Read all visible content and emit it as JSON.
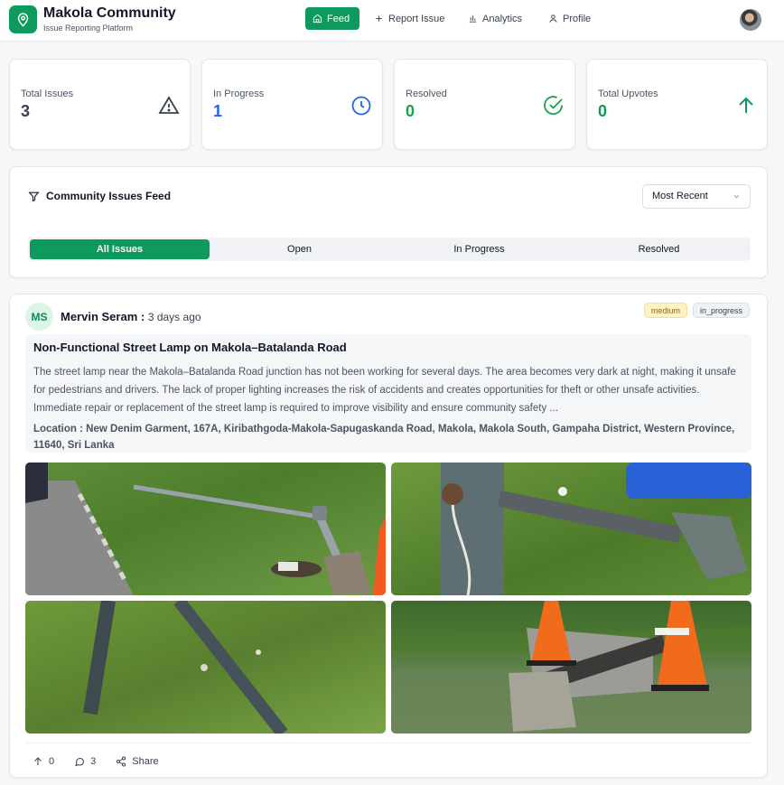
{
  "app": {
    "title": "Makola Community",
    "subtitle": "Issue Reporting Platform"
  },
  "nav": {
    "feed": "Feed",
    "report": "Report Issue",
    "analytics": "Analytics",
    "profile": "Profile"
  },
  "stats": [
    {
      "label": "Total Issues",
      "value": "3",
      "color": "#374151",
      "icon": "warning-icon"
    },
    {
      "label": "In Progress",
      "value": "1",
      "color": "#2563eb",
      "icon": "clock-icon"
    },
    {
      "label": "Resolved",
      "value": "0",
      "color": "#16a34a",
      "icon": "check-circle-icon"
    },
    {
      "label": "Total Upvotes",
      "value": "0",
      "color": "#0d9a5c",
      "icon": "arrow-up-icon"
    }
  ],
  "feed": {
    "title": "Community Issues Feed",
    "sort": "Most Recent",
    "tabs": [
      "All Issues",
      "Open",
      "In Progress",
      "Resolved"
    ],
    "active_tab": "All Issues"
  },
  "post": {
    "initials": "MS",
    "author": "Mervin Seram :",
    "time": "3 days ago",
    "severity": "medium",
    "status": "in_progress",
    "title": "Non-Functional Street Lamp on Makola–Batalanda Road",
    "description": "The street lamp near the Makola–Batalanda Road junction has not been working for several days. The area becomes very dark at night, making it unsafe for pedestrians and drivers. The lack of proper lighting increases the risk of accidents and creates opportunities for theft or other unsafe activities. Immediate repair or replacement of the street lamp is required to improve visibility and ensure community safety ...",
    "location": "Location : New Denim Garment, 167A, Kiribathgoda-Makola-Sapugaskanda Road, Makola, Makola South, Gampaha District, Western Province, 11640, Sri Lanka",
    "upvotes": "0",
    "comments": "3",
    "share": "Share"
  }
}
